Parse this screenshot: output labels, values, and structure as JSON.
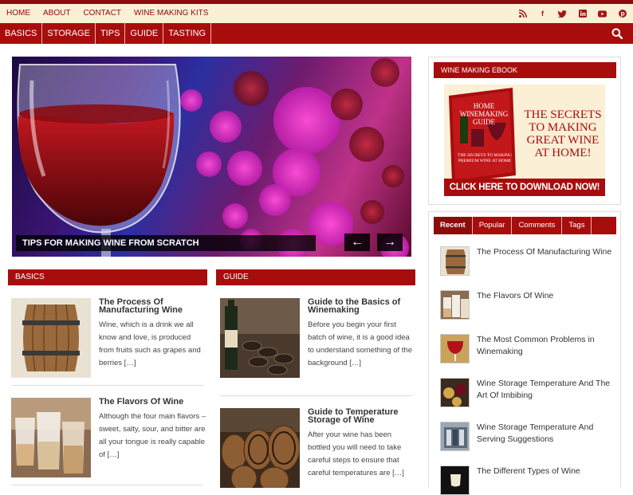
{
  "top_nav": [
    "HOME",
    "ABOUT",
    "CONTACT",
    "WINE MAKING KITS"
  ],
  "social_icons": [
    "rss-icon",
    "facebook-icon",
    "twitter-icon",
    "linkedin-icon",
    "youtube-icon",
    "pinterest-icon"
  ],
  "main_nav": [
    "BASICS",
    "STORAGE",
    "TIPS",
    "GUIDE",
    "TASTING"
  ],
  "slider": {
    "caption": "TIPS FOR MAKING WINE FROM SCRATCH",
    "prev": "←",
    "next": "→"
  },
  "sections": {
    "basics": {
      "heading": "BASICS",
      "posts": [
        {
          "title": "The Process Of Manufacturing Wine",
          "excerpt": "Wine, which is a drink we all know and love, is produced from fruits such as grapes and berries […]"
        },
        {
          "title": "The Flavors Of Wine",
          "excerpt": "Although the four main flavors – sweet, salty, sour, and bitter are all your tongue is really capable of […]"
        }
      ]
    },
    "guide": {
      "heading": "GUIDE",
      "posts": [
        {
          "title": "Guide to the Basics of Winemaking",
          "excerpt": "Before you begin your first batch of wine, it is a good idea to understand something of the background […]"
        },
        {
          "title": "Guide to Temperature Storage of Wine",
          "excerpt": "After your wine has been bottled you will need to take careful steps to ensure that careful temperatures are […]"
        }
      ]
    }
  },
  "ebook_widget": {
    "heading": "WINE MAKING EBOOK",
    "book_title": "HOME WINEMAKING GUIDE",
    "book_sub": "THE SECRETS TO MAKING PREMIUM WINE AT HOME",
    "headline_lines": [
      "THE SECRETS",
      "TO MAKING",
      "GREAT WINE",
      "AT HOME!"
    ],
    "cta": "CLICK HERE TO DOWNLOAD NOW!"
  },
  "tabs_widget": {
    "tabs": [
      "Recent",
      "Popular",
      "Comments",
      "Tags"
    ],
    "active": 0,
    "items": [
      "The Process Of Manufacturing Wine",
      "The Flavors Of Wine",
      "The Most Common Problems in Winemaking",
      "Wine Storage Temperature And The Art Of Imbibing",
      "Wine Storage Temperature And Serving Suggestions",
      "The Different Types of Wine"
    ]
  },
  "colors": {
    "brand_red": "#a80d0d",
    "dark_red": "#8c0b0b",
    "topbar_bg": "#fbefd6"
  }
}
